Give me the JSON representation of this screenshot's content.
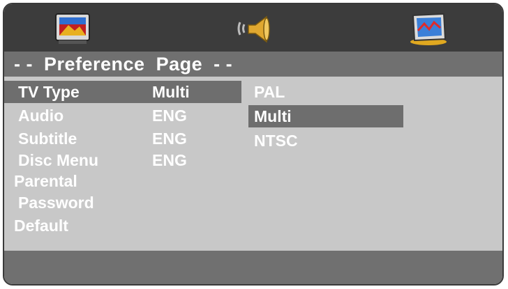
{
  "header": {
    "tabs": [
      {
        "icon": "tv-monitor-icon"
      },
      {
        "icon": "speaker-audio-icon"
      },
      {
        "icon": "preference-picture-icon"
      }
    ],
    "page_title": "- -  Preference  Page  - -"
  },
  "menu": {
    "items": [
      {
        "label": "TV Type",
        "value": "Multi",
        "selected": true
      },
      {
        "label": "Audio",
        "value": "ENG",
        "selected": false
      },
      {
        "label": "Subtitle",
        "value": "ENG",
        "selected": false
      },
      {
        "label": "Disc Menu",
        "value": "ENG",
        "selected": false
      },
      {
        "label": "Parental",
        "value": "",
        "selected": false
      },
      {
        "label": "Password",
        "value": "",
        "selected": false
      },
      {
        "label": "Default",
        "value": "",
        "selected": false
      }
    ]
  },
  "options": {
    "items": [
      {
        "label": "PAL",
        "selected": false
      },
      {
        "label": "Multi",
        "selected": true
      },
      {
        "label": "NTSC",
        "selected": false
      }
    ]
  },
  "colors": {
    "topbar": "#3c3c3c",
    "title_bar": "#707070",
    "content_bg": "#c8c8c8",
    "highlight": "#6e6e6e",
    "text": "#ffffff"
  }
}
